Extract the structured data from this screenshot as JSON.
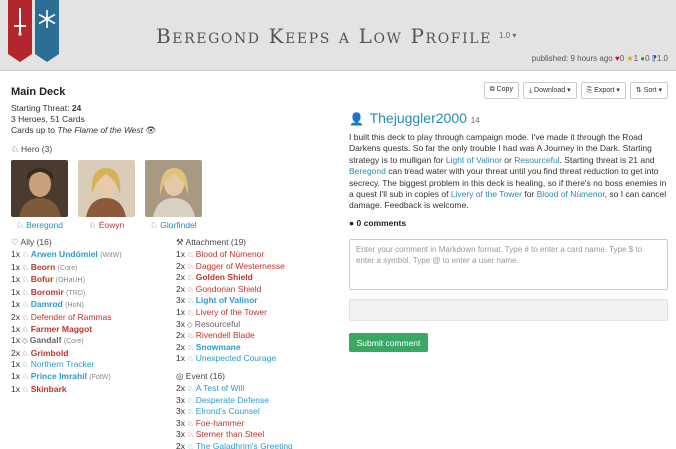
{
  "header": {
    "title": "Beregond Keeps a Low Profile",
    "version": "1.0 ▾",
    "published": "published: 9 hours ago",
    "likes": "0",
    "favorites": "1",
    "comments": "0",
    "version_count": "1.0"
  },
  "deck": {
    "heading": "Main Deck",
    "starting_threat_label": "Starting Threat:",
    "starting_threat": "24",
    "counts": "3 Heroes, 51 Cards",
    "cards_up_to_label": "Cards up to",
    "cards_up_to": "The Flame of the West"
  },
  "heroes_heading": "Hero (3)",
  "heroes": [
    {
      "name": "Beregond",
      "sphere": "spirit"
    },
    {
      "name": "Éowyn",
      "sphere": "tactics"
    },
    {
      "name": "Glorfindel",
      "sphere": "spirit"
    }
  ],
  "ally_heading": "Ally (16)",
  "allies": [
    {
      "qty": "1x",
      "name": "Arwen Undómiel",
      "set": "(WitW)",
      "sphere": "spirit",
      "bold": true
    },
    {
      "qty": "1x",
      "name": "Beorn",
      "set": "(Core)",
      "sphere": "tactics",
      "bold": true
    },
    {
      "qty": "1x",
      "name": "Bofur",
      "set": "(OHaUH)",
      "sphere": "tactics",
      "bold": true
    },
    {
      "qty": "1x",
      "name": "Boromir",
      "set": "(TRD)",
      "sphere": "tactics",
      "bold": true
    },
    {
      "qty": "1x",
      "name": "Damrod",
      "set": "(HoN)",
      "sphere": "spirit",
      "bold": true
    },
    {
      "qty": "2x",
      "name": "Defender of Rammas",
      "set": "",
      "sphere": "tactics",
      "bold": false
    },
    {
      "qty": "1x",
      "name": "Farmer Maggot",
      "set": "",
      "sphere": "tactics",
      "bold": true
    },
    {
      "qty": "1x",
      "name": "Gandalf",
      "set": "(Core)",
      "sphere": "neutral",
      "bold": true
    },
    {
      "qty": "2x",
      "name": "Grimbold",
      "set": "",
      "sphere": "tactics",
      "bold": true
    },
    {
      "qty": "1x",
      "name": "Northern Tracker",
      "set": "",
      "sphere": "spirit",
      "bold": false
    },
    {
      "qty": "1x",
      "name": "Prince Imrahil",
      "set": "(FotW)",
      "sphere": "spirit",
      "bold": true
    },
    {
      "qty": "1x",
      "name": "Skinbark",
      "set": "",
      "sphere": "tactics",
      "bold": true
    }
  ],
  "attachment_heading": "Attachment (19)",
  "attachments": [
    {
      "qty": "1x",
      "name": "Blood of Númenor",
      "sphere": "tactics",
      "bold": false
    },
    {
      "qty": "2x",
      "name": "Dagger of Westernesse",
      "sphere": "tactics",
      "bold": false
    },
    {
      "qty": "2x",
      "name": "Golden Shield",
      "sphere": "tactics",
      "bold": true
    },
    {
      "qty": "2x",
      "name": "Gondorian Shield",
      "sphere": "tactics",
      "bold": false
    },
    {
      "qty": "3x",
      "name": "Light of Valinor",
      "sphere": "spirit",
      "bold": true
    },
    {
      "qty": "1x",
      "name": "Livery of the Tower",
      "sphere": "tactics",
      "bold": false
    },
    {
      "qty": "3x",
      "name": "Resourceful",
      "sphere": "neutral",
      "bold": false
    },
    {
      "qty": "2x",
      "name": "Rivendell Blade",
      "sphere": "tactics",
      "bold": false
    },
    {
      "qty": "2x",
      "name": "Snowmane",
      "sphere": "spirit",
      "bold": true
    },
    {
      "qty": "1x",
      "name": "Unexpected Courage",
      "sphere": "spirit",
      "bold": false
    }
  ],
  "event_heading": "Event (16)",
  "events": [
    {
      "qty": "2x",
      "name": "A Test of Will",
      "sphere": "spirit"
    },
    {
      "qty": "3x",
      "name": "Desperate Defense",
      "sphere": "spirit"
    },
    {
      "qty": "3x",
      "name": "Elrond's Counsel",
      "sphere": "spirit"
    },
    {
      "qty": "3x",
      "name": "Foe-hammer",
      "sphere": "tactics"
    },
    {
      "qty": "3x",
      "name": "Sterner than Steel",
      "sphere": "tactics"
    },
    {
      "qty": "2x",
      "name": "The Galadhrim's Greeting",
      "sphere": "spirit"
    }
  ],
  "toolbar": {
    "copy": "Copy",
    "download": "Download ▾",
    "export": "Export ▾",
    "sort": "Sort ▾"
  },
  "author": {
    "name": "Thejuggler2000",
    "reputation": "14"
  },
  "description": {
    "p1": "I built this deck to play through campaign mode. I've made it through the Road Darkens quests. So far the only trouble I had was A Journey in the Dark. Starting strategy is to mulligan for ",
    "l1": "Light of Valinor",
    "p2": " or ",
    "l2": "Resourceful",
    "p3": ". Starting threat is 21 and ",
    "l3": "Beregond",
    "p4": " can tread water with your threat until you find threat reduction to get into secrecy. The biggest problem in this deck is healing, so if there's no boss enemies in a quest I'll sub in copies of ",
    "l4": "Livery of the Tower",
    "p5": " for ",
    "l5": "Blood of Númenor",
    "p6": ", so I can cancel damage. Feedback is welcome."
  },
  "comments": {
    "heading": "0 comments",
    "placeholder": "Enter your comment in Markdown format. Type # to enter a card name. Type $ to enter a symbol. Type @ to enter a user name.",
    "submit": "Submit comment"
  },
  "colors": {
    "spirit": "#2a9dcc",
    "tactics": "#c0352b",
    "accent": "#2a8cb4",
    "submit": "#3aa865"
  }
}
